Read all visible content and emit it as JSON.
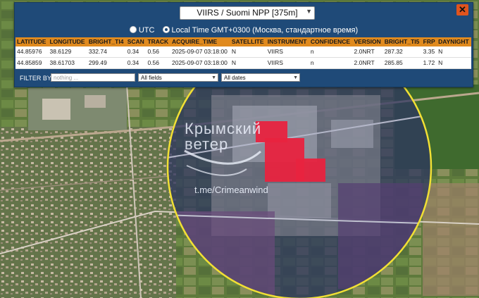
{
  "source_select": {
    "value": "VIIRS / Suomi NPP [375m]"
  },
  "close_label": "✕",
  "timezone": {
    "utc_label": "UTC",
    "local_label": "Local Time GMT+0300 (Москва, стандартное время)",
    "selected": "local"
  },
  "table": {
    "columns": [
      "LATITUDE",
      "LONGITUDE",
      "BRIGHT_TI4",
      "SCAN",
      "TRACK",
      "ACQUIRE_TIME",
      "SATELLITE",
      "INSTRUMENT",
      "CONFIDENCE",
      "VERSION",
      "BRIGHT_TI5",
      "FRP",
      "DAYNIGHT"
    ],
    "rows": [
      [
        "44.85976",
        "38.6129",
        "332.74",
        "0.34",
        "0.56",
        "2025-09-07 03:18:00",
        "N",
        "VIIRS",
        "n",
        "2.0NRT",
        "287.32",
        "3.35",
        "N"
      ],
      [
        "44.85859",
        "38.61703",
        "299.49",
        "0.34",
        "0.56",
        "2025-09-07 03:18:00",
        "N",
        "VIIRS",
        "n",
        "2.0NRT",
        "285.85",
        "1.72",
        "N"
      ]
    ]
  },
  "filter": {
    "label": "FILTER BY",
    "placeholder": "nothing ...",
    "fields_value": "All fields",
    "dates_value": "All dates"
  },
  "watermark": {
    "line1": "Крымский",
    "line2": "ветер",
    "url": "t.me/Crimeanwind"
  },
  "colors": {
    "panel": "#1f4a78",
    "header": "#e08a1e",
    "close": "#e0541e",
    "hotspot": "#e8233f",
    "circle": "#f2e034"
  }
}
